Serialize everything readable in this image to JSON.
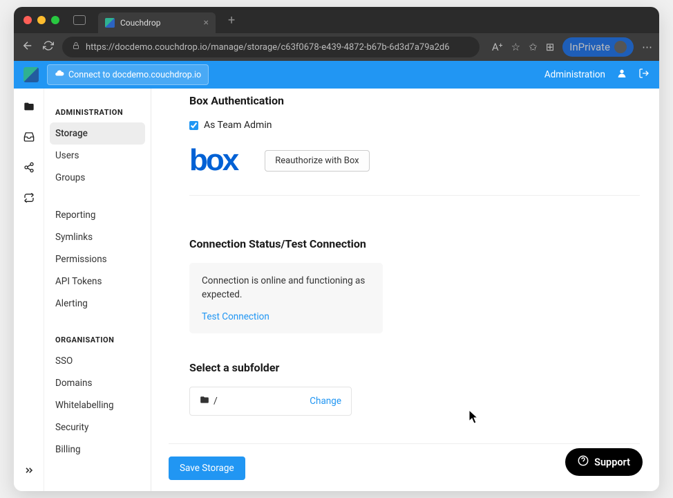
{
  "browser": {
    "tab_title": "Couchdrop",
    "url": "https://docdemo.couchdrop.io/manage/storage/c63f0678-e439-4872-b67b-6d3d7a79a2d6",
    "inprivate_label": "InPrivate"
  },
  "header": {
    "connect_label": "Connect to docdemo.couchdrop.io",
    "admin_link": "Administration"
  },
  "sidebar": {
    "heading1": "ADMINISTRATION",
    "items1": [
      "Storage",
      "Users",
      "Groups"
    ],
    "items2": [
      "Reporting",
      "Symlinks",
      "Permissions",
      "API Tokens",
      "Alerting"
    ],
    "heading2": "ORGANISATION",
    "items3": [
      "SSO",
      "Domains",
      "Whitelabelling",
      "Security",
      "Billing"
    ],
    "active": "Storage"
  },
  "content": {
    "auth_title": "Box Authentication",
    "as_team_admin_label": "As Team Admin",
    "as_team_admin_checked": true,
    "box_logo_text": "box",
    "reauth_label": "Reauthorize with Box",
    "status_title": "Connection Status/Test Connection",
    "status_text": "Connection is online and functioning as expected.",
    "test_link": "Test Connection",
    "subfolder_title": "Select a subfolder",
    "subfolder_path": "/",
    "change_label": "Change",
    "save_label": "Save Storage"
  },
  "support": {
    "label": "Support"
  }
}
